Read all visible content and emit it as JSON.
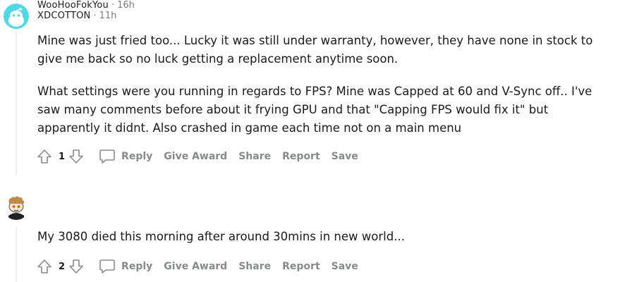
{
  "comments": [
    {
      "author": "XDCOTTON",
      "separator": "·",
      "time": "11h",
      "paragraphs": [
        "Mine was just fried too... Lucky it was still under warranty, however, they have none in stock to give me back so no luck getting a replacement anytime soon.",
        "What settings were you running in regards to FPS? Mine was Capped at 60 and V-Sync off.. I've saw many comments before about it frying GPU and that \"Capping FPS would fix it\" but apparently it didnt. Also crashed in game each time not on a main menu"
      ],
      "score": "1",
      "actions": {
        "reply": "Reply",
        "give_award": "Give Award",
        "share": "Share",
        "report": "Report",
        "save": "Save"
      },
      "avatar_icon": "snoo-avatar-icon",
      "avatar_bg": "#4fd8e6"
    },
    {
      "author": "WooHooFokYou",
      "separator": "·",
      "time": "16h",
      "paragraphs": [
        "My 3080 died this morning after around 30mins in new world..."
      ],
      "score": "2",
      "actions": {
        "reply": "Reply",
        "give_award": "Give Award",
        "share": "Share",
        "report": "Report",
        "save": "Save"
      },
      "avatar_icon": "snoo-avatar-icon",
      "avatar_bg": "#ffffff"
    }
  ],
  "icons": {
    "upvote": "upvote-arrow-icon",
    "downvote": "downvote-arrow-icon",
    "reply": "speech-bubble-icon"
  }
}
